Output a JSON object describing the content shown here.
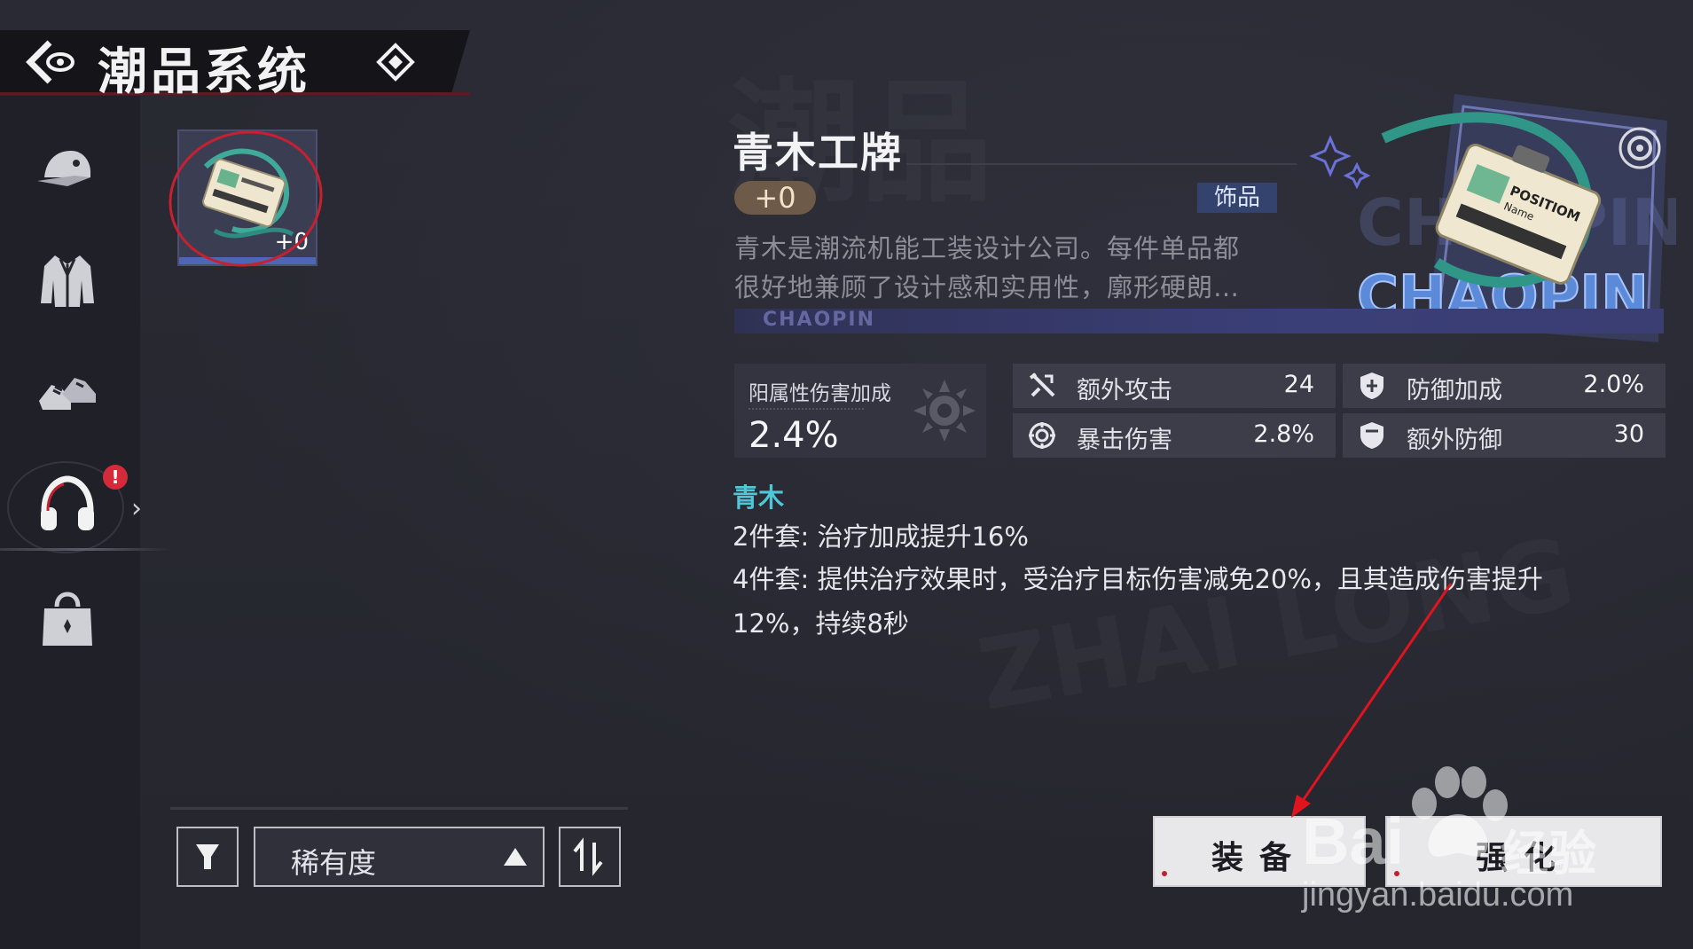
{
  "header": {
    "title": "潮品系统",
    "back_icon": "back-eye-icon",
    "extra_icon": "diamond-icon"
  },
  "sidebar": {
    "items": [
      {
        "name": "hat",
        "icon": "cap-icon"
      },
      {
        "name": "jacket",
        "icon": "jacket-icon"
      },
      {
        "name": "shoes",
        "icon": "sneakers-icon"
      },
      {
        "name": "accessory",
        "icon": "headphones-icon",
        "badge": "!"
      },
      {
        "name": "bag",
        "icon": "bag-icon"
      }
    ]
  },
  "inventory": {
    "items": [
      {
        "level": "+0"
      }
    ]
  },
  "controls": {
    "sort_label": "稀有度"
  },
  "detail": {
    "name": "青木工牌",
    "enhance": "+0",
    "type": "饰品",
    "desc_line1": "青木是潮流机能工装设计公司。每件单品都",
    "desc_line2": "很好地兼顾了设计感和实用性，廓形硬朗…",
    "banner": "CHAOPIN",
    "hero_text": "CHAOPIN",
    "card_text1": "POSITIOM",
    "card_text2": "Name",
    "main_stat": {
      "label": "阳属性伤害加成",
      "value": "2.4%"
    },
    "stats": [
      {
        "icon": "sword-icon",
        "name": "额外攻击",
        "value": "24"
      },
      {
        "icon": "shield-plus-icon",
        "name": "防御加成",
        "value": "2.0%"
      },
      {
        "icon": "crit-target-icon",
        "name": "暴击伤害",
        "value": "2.8%"
      },
      {
        "icon": "shield-icon",
        "name": "额外防御",
        "value": "30"
      }
    ],
    "set": {
      "name": "青木",
      "bonus2": "2件套: 治疗加成提升16%",
      "bonus4_line1": "4件套: 提供治疗效果时，受治疗目标伤害减免20%，且其造成伤害提升",
      "bonus4_line2": "12%，持续8秒"
    }
  },
  "actions": {
    "equip": "装备",
    "enhance": "强化"
  },
  "watermark": {
    "brand": "Bai",
    "brand_suffix": "经验",
    "url": "jingyan.baidu.com"
  },
  "colors": {
    "accent_cyan": "#4ec8d6",
    "alert_red": "#d42a3a",
    "tag_blue": "#33436d",
    "annotation_arrow": "#e0141e"
  }
}
